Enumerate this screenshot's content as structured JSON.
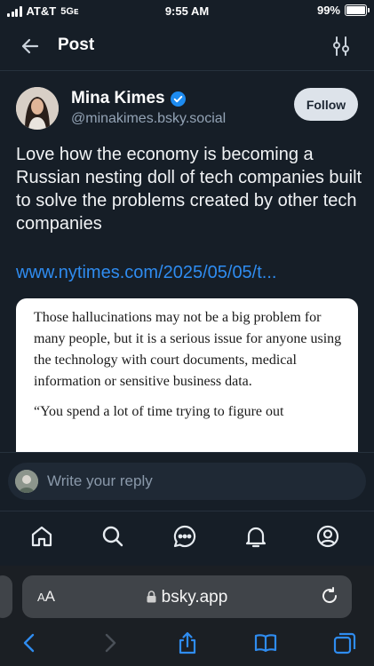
{
  "status": {
    "carrier": "AT&T",
    "network": "5Gᴇ",
    "time": "9:55 AM",
    "battery": "99%",
    "battery_level": 0.99
  },
  "header": {
    "title": "Post",
    "back_icon": "arrow-left-icon",
    "settings_icon": "sliders-icon"
  },
  "post": {
    "author_name": "Mina Kimes",
    "author_handle": "@minakimes.bsky.social",
    "follow_label": "Follow",
    "text": "Love how the economy is becoming a Russian nesting doll of tech companies built to solve the problems created by other tech companies",
    "link": "www.nytimes.com/2025/05/05/t...",
    "embed_paragraphs": [
      "Those hallucinations may not be a big problem for many people, but it is a serious issue for anyone using the technology with court documents, medical information or sensitive business data.",
      "“You spend a lot of time trying to figure out"
    ]
  },
  "reply": {
    "placeholder": "Write your reply"
  },
  "tabs": [
    "home-icon",
    "search-icon",
    "chat-icon",
    "notifications-icon",
    "profile-icon"
  ],
  "browser": {
    "text_size_label": "AA",
    "url": "bsky.app"
  },
  "colors": {
    "background": "#161e27",
    "link": "#2f8cf0",
    "verified": "#1d8bf0"
  }
}
